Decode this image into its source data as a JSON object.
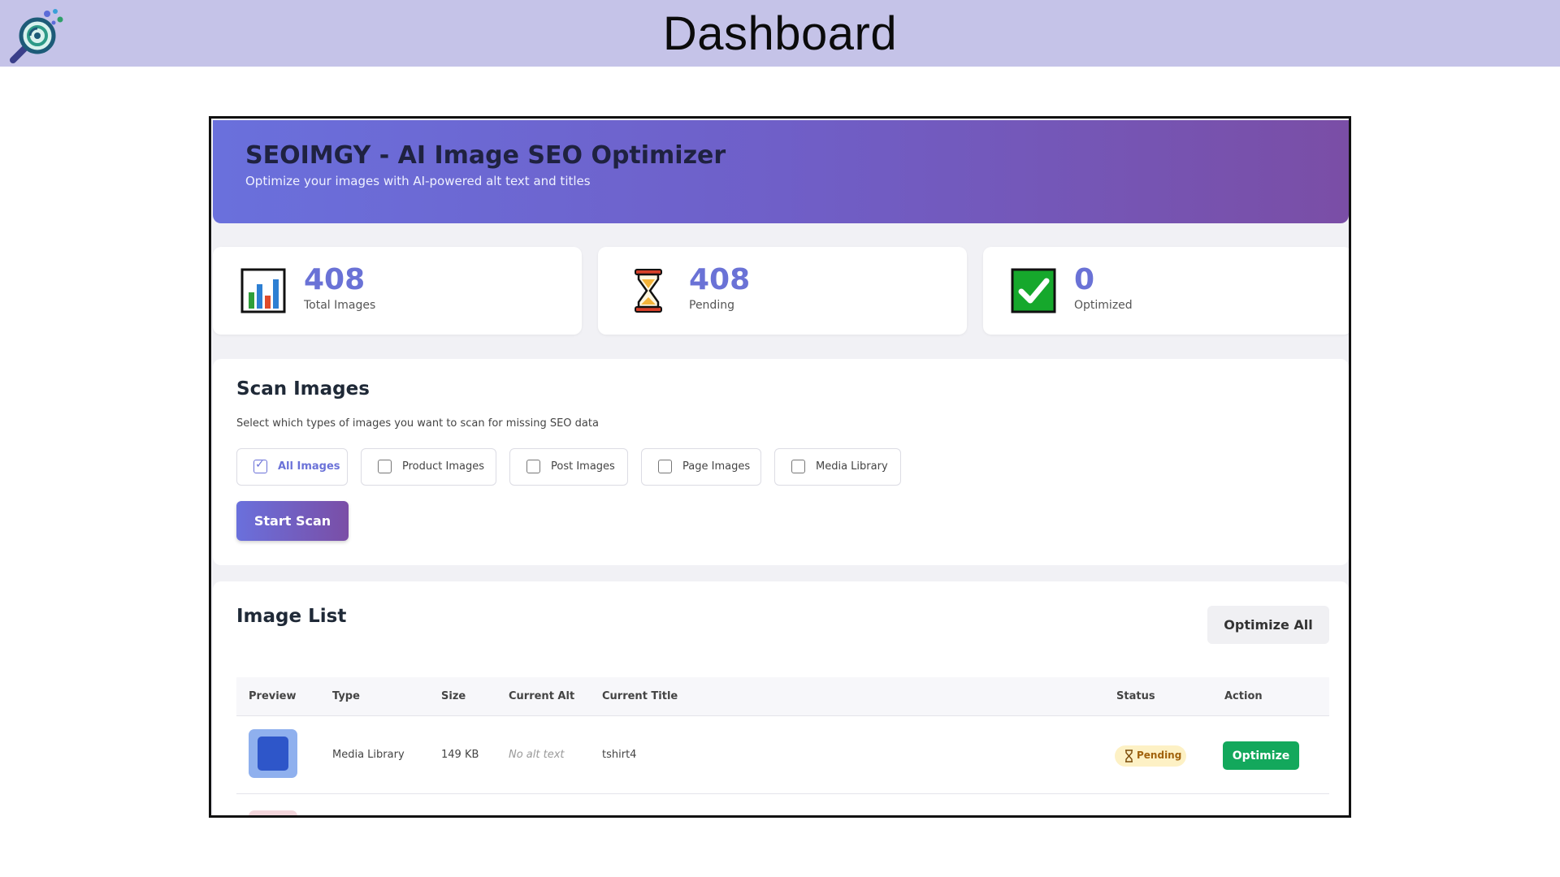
{
  "banner": {
    "title": "Dashboard"
  },
  "app": {
    "title": "SEOIMGY - AI Image SEO Optimizer",
    "subtitle": "Optimize your images with AI-powered alt text and titles"
  },
  "stats": [
    {
      "value": "408",
      "label": "Total Images",
      "icon": "bar-chart-icon"
    },
    {
      "value": "408",
      "label": "Pending",
      "icon": "hourglass-icon"
    },
    {
      "value": "0",
      "label": "Optimized",
      "icon": "check-mark-icon"
    }
  ],
  "scan": {
    "title": "Scan Images",
    "description": "Select which types of images you want to scan for missing SEO data",
    "options": [
      {
        "label": "All Images",
        "checked": true
      },
      {
        "label": "Product Images",
        "checked": false
      },
      {
        "label": "Post Images",
        "checked": false
      },
      {
        "label": "Page Images",
        "checked": false
      },
      {
        "label": "Media Library",
        "checked": false
      }
    ],
    "start_label": "Start Scan"
  },
  "image_list": {
    "title": "Image List",
    "optimize_all_label": "Optimize All",
    "columns": [
      "Preview",
      "Type",
      "Size",
      "Current Alt",
      "Current Title",
      "Status",
      "Action"
    ],
    "rows": [
      {
        "type": "Media Library",
        "size": "149 KB",
        "alt": "No alt text",
        "title": "tshirt4",
        "status": "Pending",
        "action": "Optimize"
      }
    ]
  },
  "colors": {
    "banner_bg": "#c5c3e8",
    "accent": "#6a72d6",
    "gradient_start": "#6a70dc",
    "gradient_end": "#7a4ea6",
    "optimize_green": "#13a85c",
    "pending_bg": "#fdf1c5"
  }
}
